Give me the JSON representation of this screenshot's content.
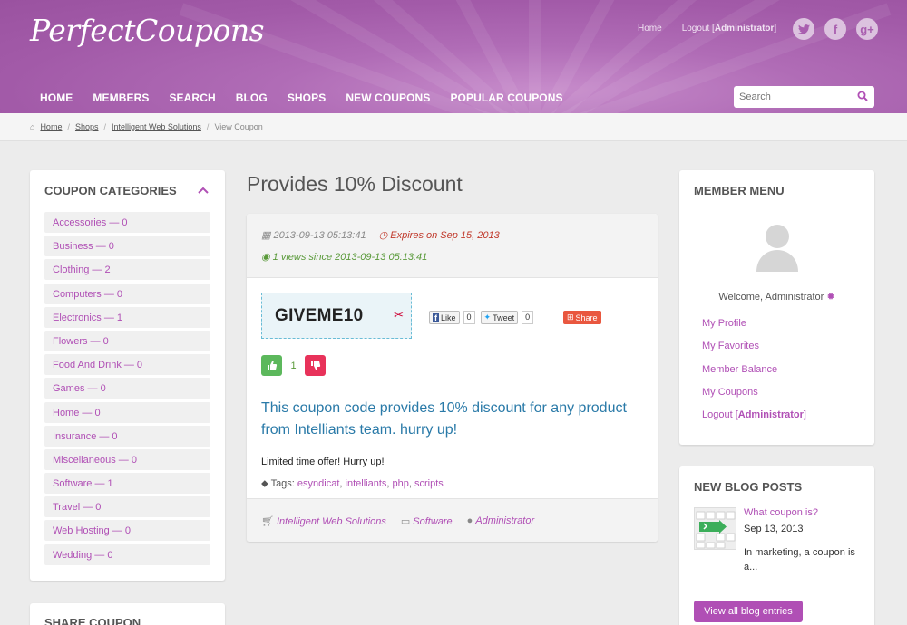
{
  "header": {
    "logo": "PerfectCoupons",
    "top_links": {
      "home": "Home",
      "logout": "Logout [",
      "logout_user": "Administrator",
      "logout_end": "]"
    },
    "nav": [
      "HOME",
      "MEMBERS",
      "SEARCH",
      "BLOG",
      "SHOPS",
      "NEW COUPONS",
      "POPULAR COUPONS"
    ],
    "search_placeholder": "Search",
    "social": {
      "twitter": "t",
      "facebook": "f",
      "google": "g+"
    }
  },
  "breadcrumb": [
    "Home",
    "Shops",
    "Intelligent Web Solutions",
    "View Coupon"
  ],
  "categories": {
    "title": "COUPON CATEGORIES",
    "items": [
      "Accessories — 0",
      "Business — 0",
      "Clothing — 2",
      "Computers — 0",
      "Electronics — 1",
      "Flowers — 0",
      "Food And Drink — 0",
      "Games — 0",
      "Home — 0",
      "Insurance — 0",
      "Miscellaneous — 0",
      "Software — 1",
      "Travel — 0",
      "Web Hosting — 0",
      "Wedding — 0"
    ]
  },
  "share_panel": {
    "title": "SHARE COUPON"
  },
  "coupon": {
    "title": "Provides 10% Discount",
    "date": "2013-09-13 05:13:41",
    "expires": "Expires on Sep 15, 2013",
    "views": "1 views since 2013-09-13 05:13:41",
    "code": "GIVEME10",
    "like_label": "Like",
    "like_count": "0",
    "tweet_label": "Tweet",
    "tweet_count": "0",
    "share_label": "Share",
    "vote_count": "1",
    "description": "This coupon code provides 10% discount for any product from Intelliants team. hurry up!",
    "limited": "Limited time offer! Hurry up!",
    "tags_label": "Tags:",
    "tags": [
      "esyndicat",
      "intelliants",
      "php",
      "scripts"
    ],
    "shop": "Intelligent Web Solutions",
    "category": "Software",
    "author": "Administrator"
  },
  "member_menu": {
    "title": "MEMBER MENU",
    "welcome": "Welcome, Administrator",
    "links": [
      "My Profile",
      "My Favorites",
      "Member Balance",
      "My Coupons"
    ],
    "logout": "Logout [",
    "logout_user": "Administrator",
    "logout_end": "]"
  },
  "blog": {
    "title": "NEW BLOG POSTS",
    "post_title": "What coupon is?",
    "post_date": "Sep 13, 2013",
    "post_excerpt": "In marketing, a coupon is a...",
    "view_all": "View all blog entries"
  },
  "colors": {
    "accent": "#b04fb5",
    "header": "#a85fae",
    "link_blue": "#2a7aa8"
  }
}
